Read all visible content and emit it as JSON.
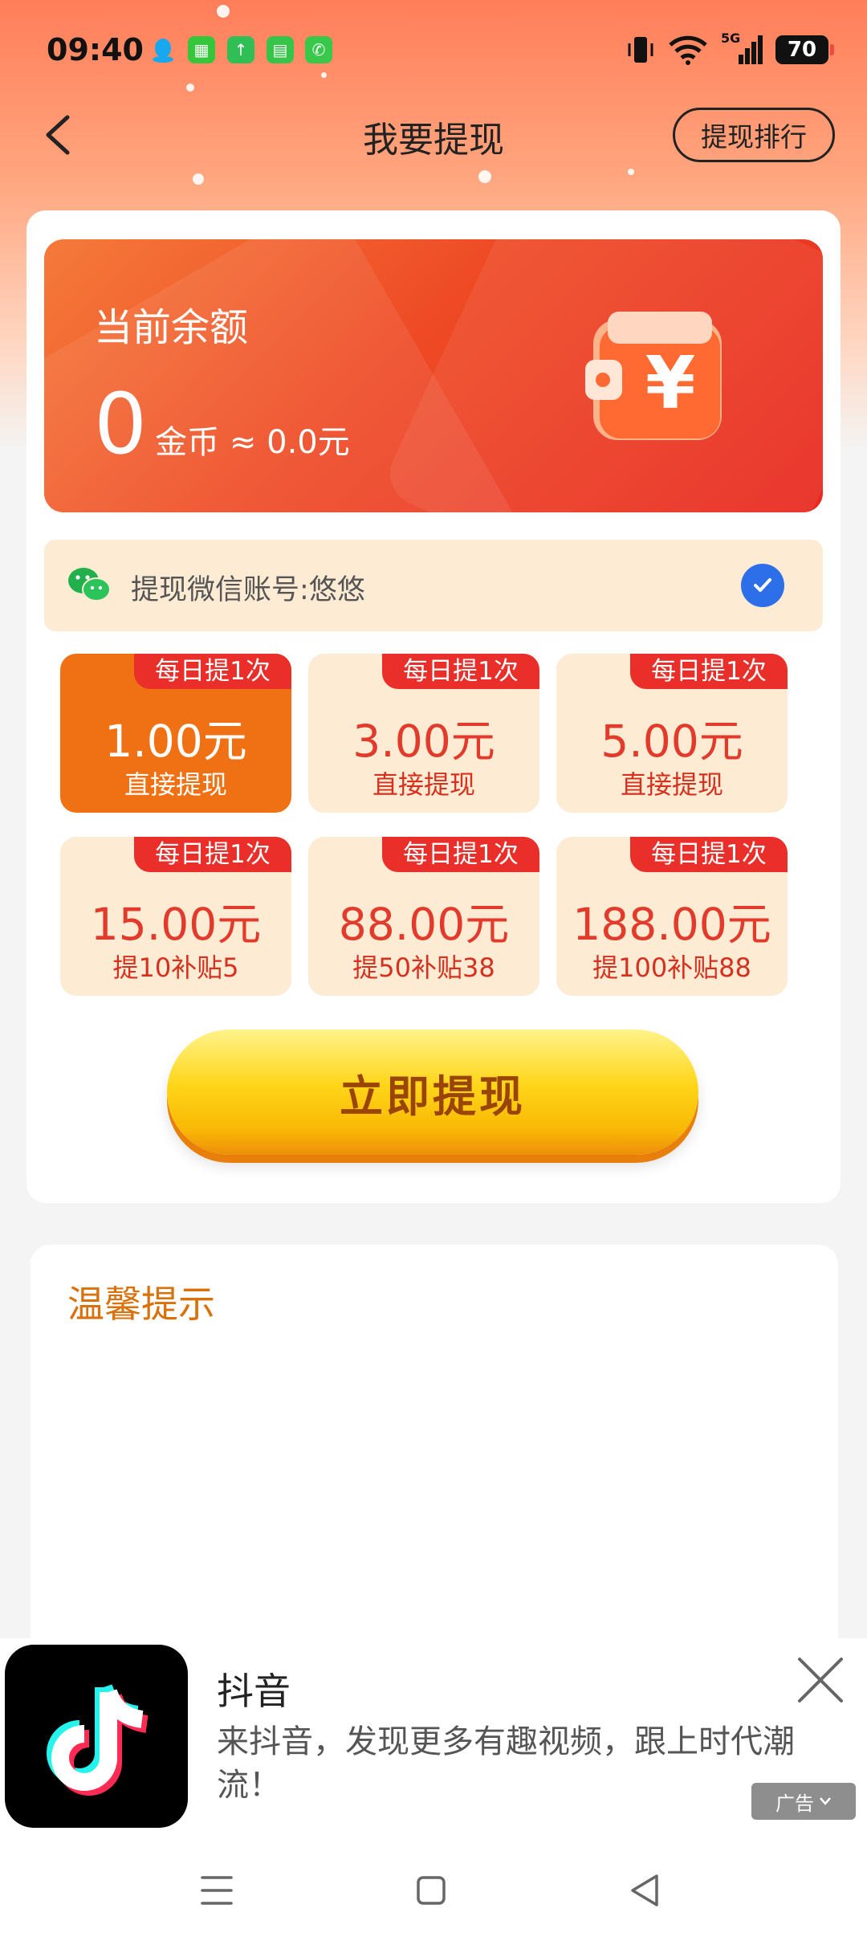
{
  "status_bar": {
    "time": "09:40",
    "network": "5G",
    "battery": "70",
    "notification_icons": [
      "qq-icon",
      "app-store-icon",
      "upload-icon",
      "message-icon",
      "phone-icon"
    ]
  },
  "header": {
    "title": "我要提现",
    "rank_button": "提现排行"
  },
  "balance": {
    "label": "当前余额",
    "amount": "0",
    "unit_text": "金币 ≈ 0.0元"
  },
  "account": {
    "text": "提现微信账号:悠悠",
    "checked": true
  },
  "options": [
    {
      "tag": "每日提1次",
      "amount": "1.00元",
      "desc": "直接提现",
      "selected": true
    },
    {
      "tag": "每日提1次",
      "amount": "3.00元",
      "desc": "直接提现",
      "selected": false
    },
    {
      "tag": "每日提1次",
      "amount": "5.00元",
      "desc": "直接提现",
      "selected": false
    },
    {
      "tag": "每日提1次",
      "amount": "15.00元",
      "desc": "提10补贴5",
      "selected": false
    },
    {
      "tag": "每日提1次",
      "amount": "88.00元",
      "desc": "提50补贴38",
      "selected": false
    },
    {
      "tag": "每日提1次",
      "amount": "188.00元",
      "desc": "提100补贴88",
      "selected": false
    }
  ],
  "withdraw_button": "立即提现",
  "tips": {
    "title": "温馨提示"
  },
  "ad": {
    "title": "抖音",
    "description": "来抖音，发现更多有趣视频，跟上时代潮流！",
    "badge": "广告"
  },
  "colors": {
    "accent_orange": "#f07113",
    "tag_red": "#ea2f2a",
    "option_bg": "#fdebd3",
    "tips_title": "#d9720c"
  }
}
